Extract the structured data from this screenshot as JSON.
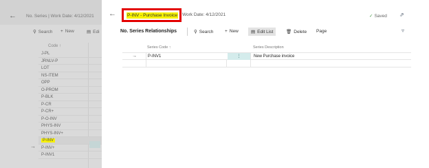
{
  "background": {
    "title": "No. Series | Work Date: 4/12/2021",
    "toolbar": {
      "search": "Search",
      "new": "New",
      "edit": "Edi"
    },
    "column_header": "Code ↑",
    "rows": [
      "J-PL",
      "JRNLV-P",
      "LOT",
      "NS-ITEM",
      "OPP",
      "O-PROM",
      "P-BLK",
      "P-CR",
      "P-CR+",
      "P-O-INV",
      "PHYS-INV",
      "PHYS-INV+",
      "P-INV",
      "P-INV+",
      "P-INV1"
    ],
    "current_row_index": 12
  },
  "dialog": {
    "title": "P-INV - Purchase Invoice",
    "work_date": "Work Date: 4/12/2021",
    "saved": "Saved",
    "toolbar": {
      "label": "No. Series Relationships",
      "search": "Search",
      "new": "New",
      "edit_list": "Edit List",
      "delete": "Delete",
      "page": "Page"
    },
    "columns": {
      "code": "Series Code ↑",
      "description": "Series Description"
    },
    "rows": [
      {
        "code": "P-INV1",
        "menu": "⋮",
        "description": "New Purchase invoice"
      }
    ]
  },
  "colors": {
    "highlight": "#f7f200",
    "title_border": "#e30000",
    "menu_cell": "#d4ecec",
    "dim_overlay": "#dadada"
  },
  "icons": [
    "back-arrow-icon",
    "search-icon",
    "plus-icon",
    "edit-list-icon",
    "delete-icon",
    "popout-icon",
    "filter-icon",
    "row-arrow-icon"
  ]
}
